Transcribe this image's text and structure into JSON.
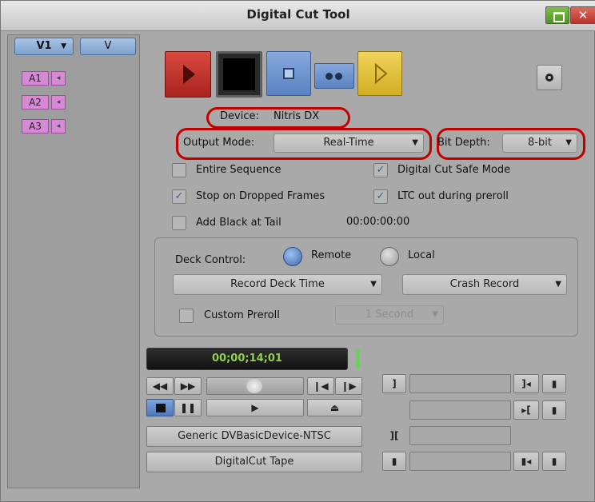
{
  "window": {
    "title": "Digital Cut Tool",
    "maximize_label": "",
    "close_label": "✕"
  },
  "tracks": {
    "video_main": "V1",
    "video_secondary": "V",
    "audio": [
      {
        "label": "A1"
      },
      {
        "label": "A2"
      },
      {
        "label": "A3"
      }
    ],
    "speaker_glyph": "◂"
  },
  "transport_buttons": {
    "record_icon": "record-play-icon",
    "stop_icon": "stop-icon",
    "dual_icon": "dual-dot-icon",
    "play_icon": "play-outline-icon",
    "options_icon": "options-dot-icon"
  },
  "device": {
    "label": "Device:",
    "value": "Nitris DX"
  },
  "output_mode": {
    "label": "Output Mode:",
    "value": "Real-Time"
  },
  "bit_depth": {
    "label": "Bit Depth:",
    "value": "8-bit"
  },
  "options": {
    "entire_sequence": {
      "label": "Entire Sequence",
      "checked": false
    },
    "safe_mode": {
      "label": "Digital Cut Safe Mode",
      "checked": true
    },
    "stop_dropped": {
      "label": "Stop on Dropped Frames",
      "checked": true
    },
    "ltc_preroll": {
      "label": "LTC out during preroll",
      "checked": true
    },
    "add_black": {
      "label": "Add Black at Tail",
      "checked": false
    },
    "black_timecode": "00:00:00:00"
  },
  "deck": {
    "label": "Deck Control:",
    "remote_label": "Remote",
    "local_label": "Local",
    "selected": "Remote",
    "time_mode": "Record Deck Time",
    "record_mode": "Crash Record",
    "custom_preroll_label": "Custom Preroll",
    "custom_preroll_checked": false,
    "preroll_value": "1 Second"
  },
  "timecode": "00;00;14;01",
  "deck_device": "Generic DVBasicDevice-NTSC",
  "tape": "DigitalCut Tape",
  "colors": {
    "record_red": "#c5312c",
    "stop_blue": "#6f96cf",
    "play_yellow": "#e3c43a",
    "timecode_green": "#8fd14a",
    "highlight_red": "#c20000",
    "selected_blue": "#4f79b8"
  }
}
